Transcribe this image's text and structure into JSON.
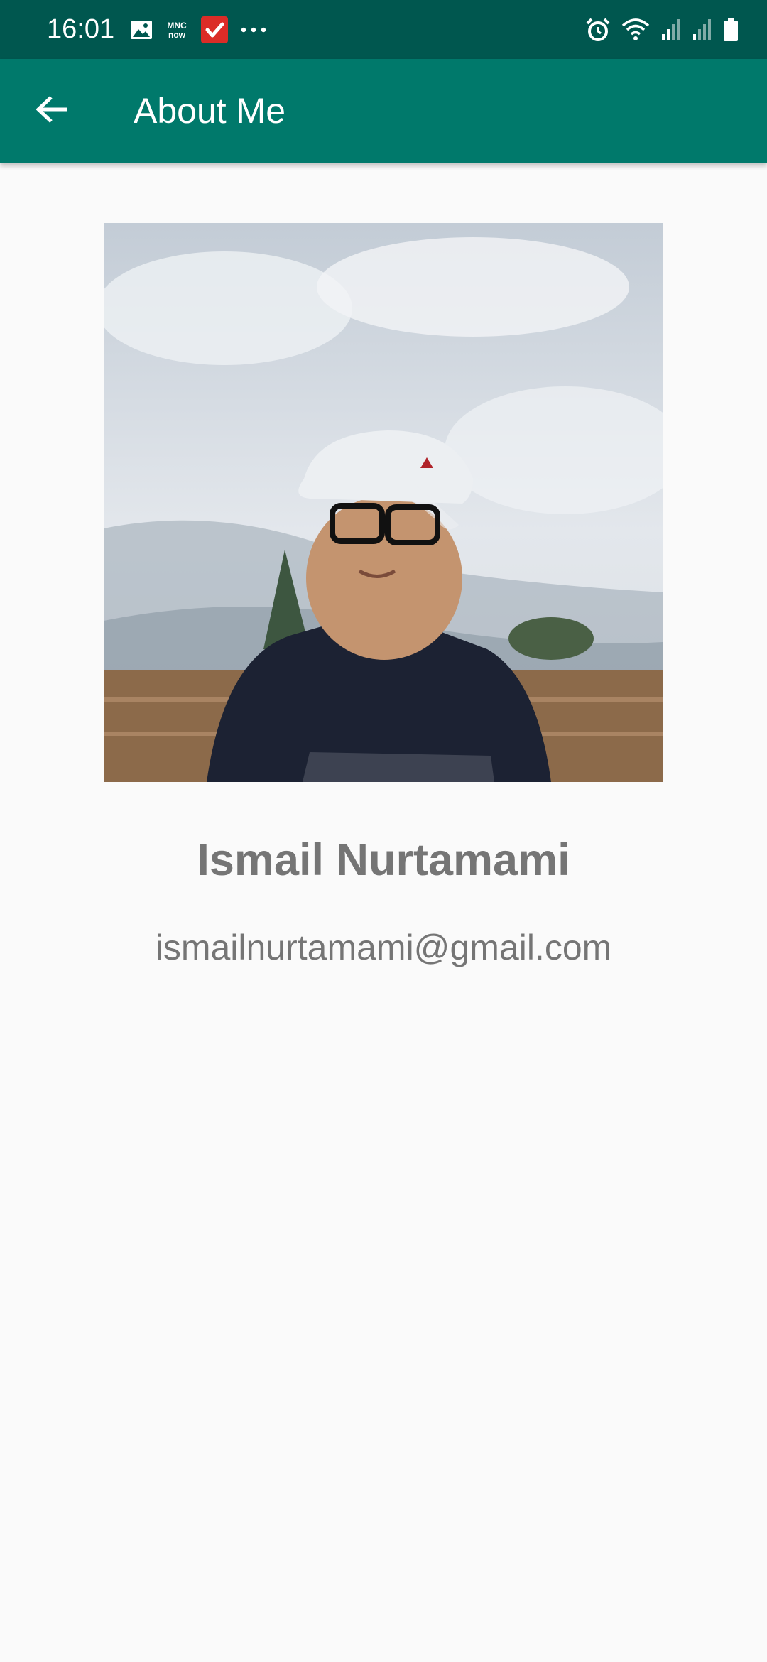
{
  "status_bar": {
    "time": "16:01",
    "left_icons": [
      "gallery-icon",
      "mnc-now-icon",
      "todoist-icon",
      "more-dots-icon"
    ],
    "right_icons": [
      "alarm-icon",
      "wifi-icon",
      "signal-icon",
      "signal-icon",
      "battery-icon"
    ]
  },
  "app_bar": {
    "back_icon": "arrow-left-icon",
    "title": "About Me",
    "color": "#00796b"
  },
  "profile": {
    "photo_icon": "profile-photo",
    "name": "Ismail Nurtamami",
    "email": "ismailnurtamami@gmail.com"
  },
  "colors": {
    "status_bar": "#00574f",
    "app_bar": "#00796b",
    "background": "#fafafa",
    "text": "#757575"
  }
}
